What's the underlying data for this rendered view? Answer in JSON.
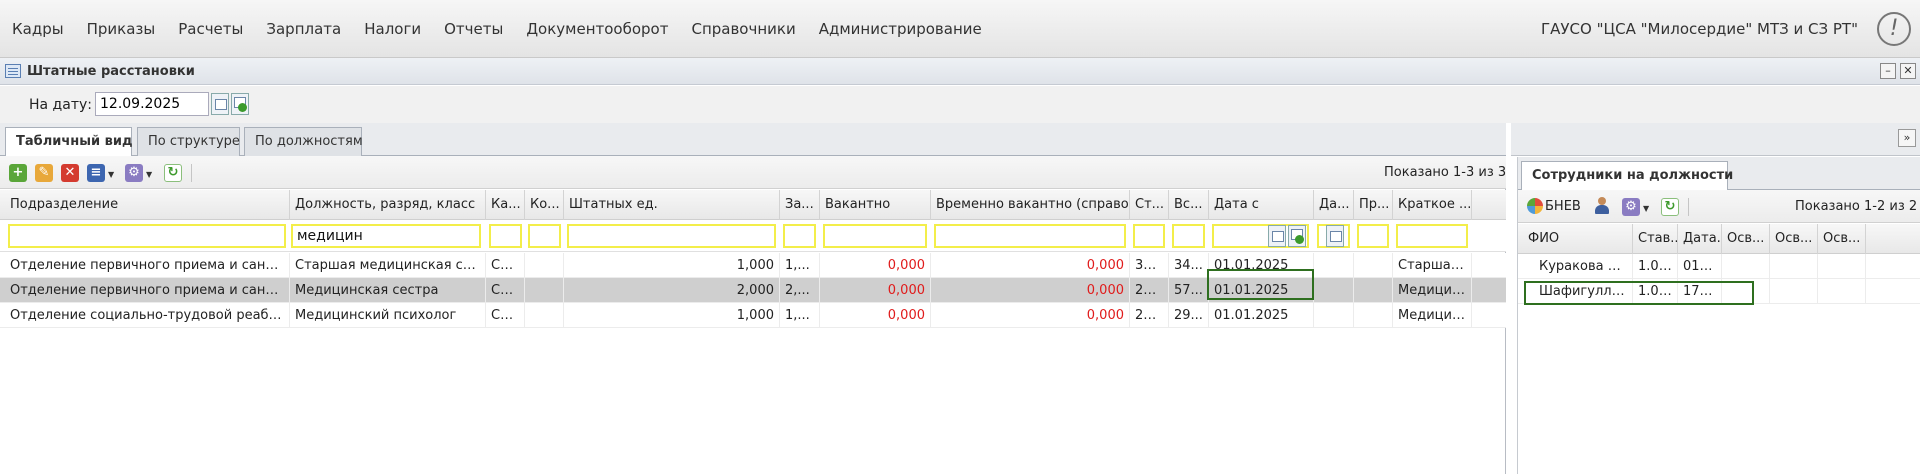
{
  "menu": [
    "Кадры",
    "Приказы",
    "Расчеты",
    "Зарплата",
    "Налоги",
    "Отчеты",
    "Документооборот",
    "Справочники",
    "Администрирование"
  ],
  "org_name": "ГАУСО \"ЦСА \"Милосердие\" МТЗ и СЗ РТ\"",
  "window": {
    "title": "Штатные расстановки"
  },
  "date_filter": {
    "label": "На дату:",
    "value": "12.09.2025"
  },
  "tabs": [
    "Табличный вид",
    "По структуре",
    "По должностям"
  ],
  "grid": {
    "shown": "Показано 1-3 из 3",
    "columns": [
      "Подразделение",
      "Должность, разряд, класс",
      "Ка...",
      "Ко...",
      "Штатных ед.",
      "За...",
      "Вакантно",
      "Временно вакантно (справо...",
      "Ст...",
      "Вс...",
      "Дата с",
      "Да...",
      "Пр...",
      "Краткое ..."
    ],
    "filter_position": "медицин",
    "rows": [
      [
        "Отделение первичного приема и санитарн...",
        "Старшая медицинская сестра",
        "Ср...",
        "",
        "1,000",
        "1,...",
        "0,000",
        "0,000",
        "34...",
        "34...",
        "01.01.2025",
        "",
        "",
        "Старшая ..."
      ],
      [
        "Отделение первичного приема и санитарн...",
        "Медицинская сестра",
        "Ср...",
        "",
        "2,000",
        "2,...",
        "0,000",
        "0,000",
        "28...",
        "57...",
        "01.01.2025",
        "",
        "",
        "Медицин..."
      ],
      [
        "Отделение социально-трудовой реабилит...",
        "Медицинский психолог",
        "Со...",
        "",
        "1,000",
        "1,...",
        "0,000",
        "0,000",
        "29...",
        "29...",
        "01.01.2025",
        "",
        "",
        "Медицин..."
      ]
    ]
  },
  "employees": {
    "tab": "Сотрудники на должности",
    "toolbar_label": "БНЕВ",
    "shown": "Показано 1-2 из 2",
    "columns": [
      "ФИО",
      "Став...",
      "Дата...",
      "Осв...",
      "Осв...",
      "Осв..."
    ],
    "rows": [
      [
        "Куракова Н...",
        "1.000",
        "01.0...",
        "",
        "",
        ""
      ],
      [
        "Шафигулли...",
        "1.000",
        "17.0...",
        "",
        "",
        ""
      ]
    ]
  }
}
